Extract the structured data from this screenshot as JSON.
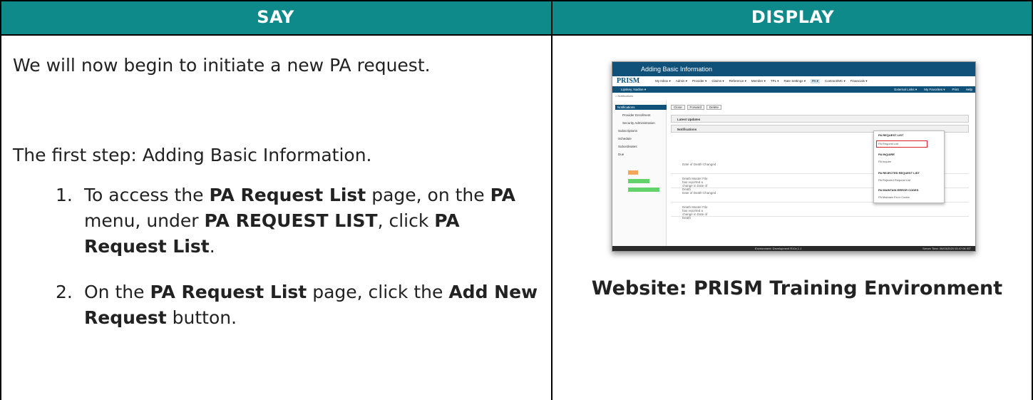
{
  "header": {
    "say": "SAY",
    "display": "DISPLAY"
  },
  "say": {
    "intro": "We will now begin to initiate a new PA request.",
    "first_step": "The first step: Adding Basic Information.",
    "steps": [
      {
        "num": "1.",
        "t1": "To access the ",
        "b1": "PA Request List",
        "t2": " page, on the ",
        "b2": "PA",
        "t3": " menu, under ",
        "b3": "PA REQUEST LIST",
        "t4": ", click ",
        "b4": "PA Request List",
        "t5": "."
      },
      {
        "num": "2.",
        "t1": "On the ",
        "b1": "PA Request List",
        "t2": " page, click the ",
        "b2": "Add New Request",
        "t3": " button."
      }
    ]
  },
  "display": {
    "caption": "Website: PRISM Training Environment",
    "screenshot": {
      "title": "Adding Basic Information",
      "logo": "PRISM",
      "menu": [
        "My Inbox ▾",
        "Admin ▾",
        "Provider ▾",
        "Claims ▾",
        "Reference ▾",
        "Member ▾",
        "TPL ▾",
        "Rate Settings ▾",
        "PA ▾",
        "Contract/MC ▾",
        "Financials ▾"
      ],
      "user": "Lipskey, Nadine ▾",
      "subbar_right": [
        "External Links ▾",
        "My Favorites ▾",
        "Print",
        "Help"
      ],
      "breadcrumb": "> Notifications",
      "sidebar": [
        "Notifications",
        "Provider Enrollment",
        "Security Administration",
        "Subscriptions",
        "Schedule",
        "Subordinates",
        "Due"
      ],
      "buttons": [
        "Close",
        "Forward",
        "Delete"
      ],
      "panels": [
        "Latest Updates",
        "Notifications"
      ],
      "dropdown": [
        "PA REQUEST LIST",
        "PA Request List",
        "PA INQUIRE",
        "PA Inquire",
        "PA REJECTED REQUEST LIST",
        "PA Rejected Request List",
        "PA MAINTAIN ERROR CODES",
        "PA Maintain Error Codes"
      ],
      "rows": [
        "Date of Death Changed",
        "Death Master File has reported a change in Date of Death",
        "Date of Death Changed",
        "Death Master File has reported a change in Date of Death"
      ],
      "footer_center": "Environment: Development R10c.1.1",
      "footer_right": "Server Time: 06/03/2020 03:47:06 IST"
    }
  }
}
